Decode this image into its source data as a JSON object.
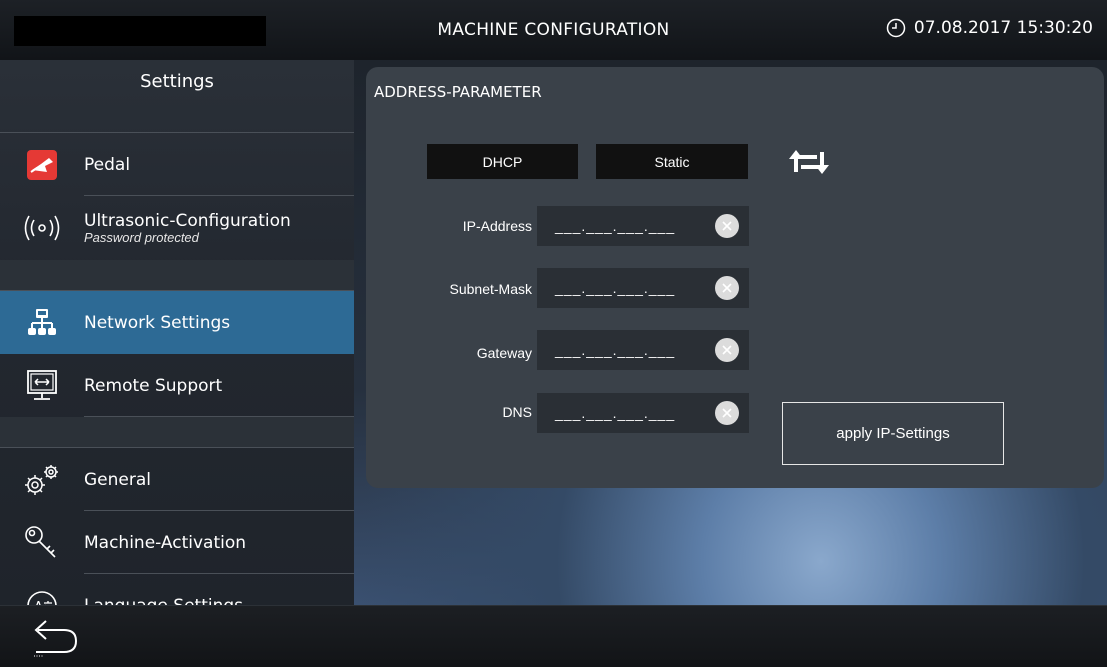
{
  "header": {
    "title": "MACHINE CONFIGURATION",
    "datetime": "07.08.2017 15:30:20",
    "clock_icon": "clock-icon"
  },
  "sidebar": {
    "title": "Settings",
    "items": [
      {
        "label": "Pedal",
        "icon": "pedal-icon"
      },
      {
        "label": "Ultrasonic-Configuration",
        "sublabel": "Password protected",
        "icon": "ultrasonic-icon"
      },
      {
        "label": "Network Settings",
        "icon": "network-icon",
        "active": true
      },
      {
        "label": "Remote Support",
        "icon": "remote-support-icon"
      },
      {
        "label": "General",
        "icon": "gears-icon"
      },
      {
        "label": "Machine-Activation",
        "icon": "key-icon"
      },
      {
        "label": "Language Settings",
        "icon": "language-icon"
      }
    ]
  },
  "panel": {
    "title": "ADDRESS-PARAMETER",
    "modes": {
      "dhcp": "DHCP",
      "static": "Static"
    },
    "fields": [
      {
        "label": "IP-Address",
        "value": "___.___.___.___"
      },
      {
        "label": "Subnet-Mask",
        "value": "___.___.___.___"
      },
      {
        "label": "Gateway",
        "value": "___.___.___.___"
      },
      {
        "label": "DNS",
        "value": "___.___.___.___"
      }
    ],
    "apply_label": "apply IP-Settings"
  },
  "colors": {
    "active_item": "#2d6a95",
    "pedal_icon_bg": "#e53935"
  }
}
